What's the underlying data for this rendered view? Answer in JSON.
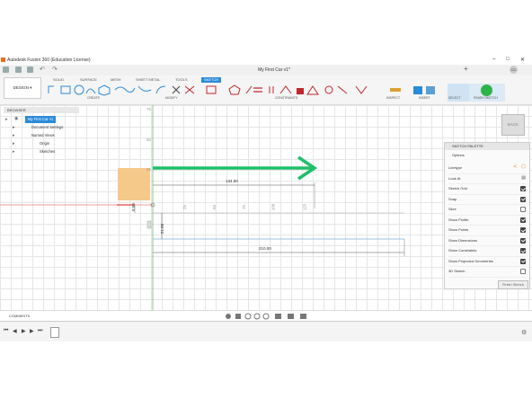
{
  "app": {
    "title": "Autodesk Fusion 360 (Education License)",
    "document_tab": "My First Car v1*",
    "avatar": "CC"
  },
  "ribbon": {
    "tabs": [
      "SOLID",
      "SURFACE",
      "MESH",
      "SHEET METAL",
      "TOOLS",
      "SKETCH"
    ],
    "active_tab": "SKETCH",
    "workspace": "DESIGN",
    "groups": [
      "CREATE",
      "MODIFY",
      "CONSTRAINTS",
      "INSPECT",
      "INSERT",
      "SELECT",
      "FINISH SKETCH"
    ]
  },
  "browser": {
    "header": "BROWSER",
    "root": "My First Car v1",
    "items": [
      "Document Settings",
      "Named Views",
      "Origin",
      "Sketches"
    ]
  },
  "palette": {
    "header": "SKETCH PALETTE",
    "section": "Options",
    "rows": [
      {
        "label": "Linetype",
        "type": "icons"
      },
      {
        "label": "Look At",
        "type": "icon"
      },
      {
        "label": "Sketch Grid",
        "checked": true
      },
      {
        "label": "Snap",
        "checked": true
      },
      {
        "label": "Slice",
        "checked": false
      },
      {
        "label": "Show Profile",
        "checked": true
      },
      {
        "label": "Show Points",
        "checked": true
      },
      {
        "label": "Show Dimensions",
        "checked": true
      },
      {
        "label": "Show Constraints",
        "checked": true
      },
      {
        "label": "Show Projected Geometries",
        "checked": true
      },
      {
        "label": "3D Sketch",
        "checked": false
      }
    ],
    "finish_button": "Finish Sketch"
  },
  "viewcube": {
    "label": "BACK"
  },
  "comments": {
    "label": "COMMENTS"
  },
  "sketch": {
    "dim_134": "134.00",
    "dim_210": "210.00",
    "dim_21": "21.00",
    "dim_8": "8.00",
    "ruler_v": [
      "75",
      "50",
      "25"
    ],
    "ruler_h": [
      "25",
      "50",
      "75",
      "100",
      "125"
    ]
  },
  "colors": {
    "accent": "#2b8ad8",
    "arrow": "#1fbf6a",
    "origin_box": "#f5c98a",
    "finish": "#2eb34a"
  }
}
